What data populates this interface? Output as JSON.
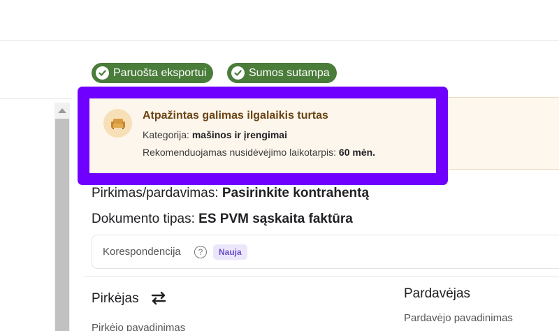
{
  "status_chips": {
    "export_ready": "Paruošta eksportui",
    "sums_match": "Sumos sutampa"
  },
  "alert": {
    "title": "Atpažintas galimas ilgalaikis turtas",
    "category_label": "Kategorija:",
    "category_value": "mašinos ir įrengimai",
    "depreciation_label": "Rekomenduojamas nusidėvėjimo laikotarpis:",
    "depreciation_value": "60 mėn.",
    "icon": "sofa-icon"
  },
  "fields": {
    "purchase_sale_label": "Pirkimas/pardavimas:",
    "purchase_sale_value": "Pasirinkite kontrahentą",
    "doc_type_label": "Dokumento tipas:",
    "doc_type_value": "ES PVM sąskaita faktūra"
  },
  "correspondence": {
    "label": "Korespondencija",
    "help_glyph": "?",
    "badge": "Nauja"
  },
  "buyer": {
    "title": "Pirkėjas",
    "name_label": "Pirkėjo pavadinimas"
  },
  "seller": {
    "title": "Pardavėjas",
    "name_label": "Pardavėjo pavadinimas"
  },
  "colors": {
    "chip_green": "#4a7c3a",
    "highlight_purple": "#6f00ff",
    "alert_bg": "#fdf6ec",
    "alert_title": "#6b4414",
    "badge_bg": "#ece6fb",
    "badge_text": "#6b4fc8"
  }
}
